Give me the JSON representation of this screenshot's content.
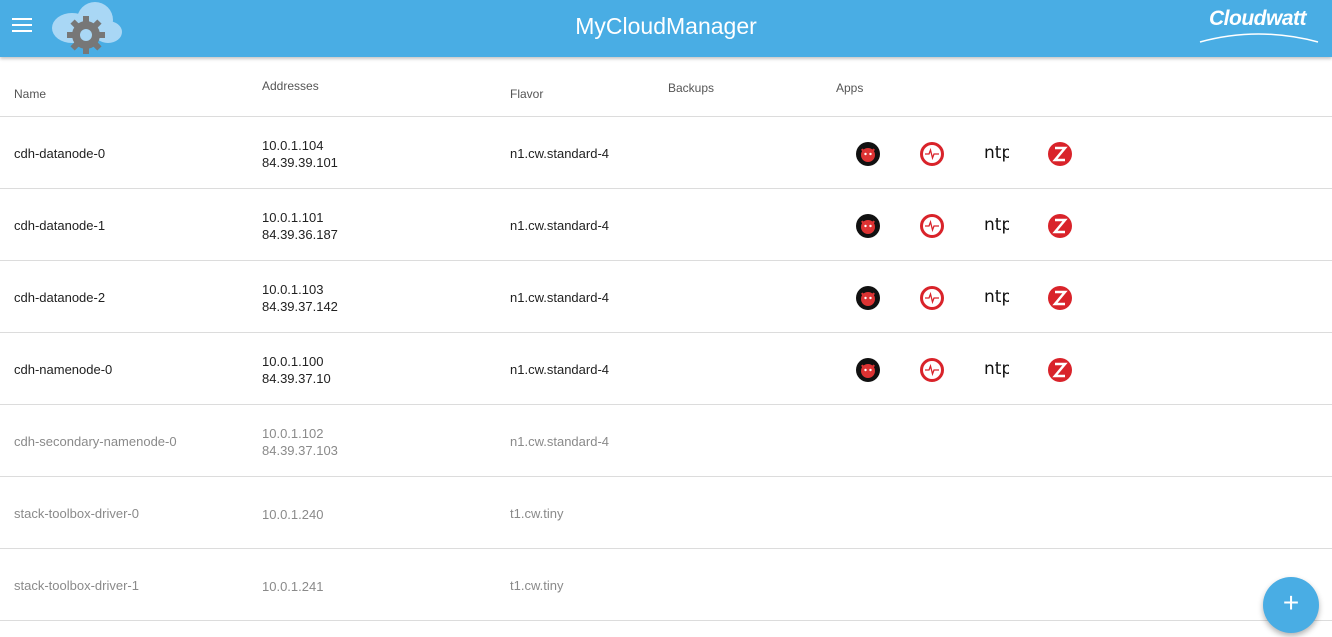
{
  "header": {
    "title": "MyCloudManager",
    "brand": "Cloudwatt",
    "menu_icon": "hamburger-menu-icon",
    "logo_icon": "cloud-gear-logo-icon",
    "background_color": "#49ade4"
  },
  "table": {
    "columns": [
      "Name",
      "Addresses",
      "Flavor",
      "Backups",
      "Apps"
    ],
    "rows": [
      {
        "name": "cdh-datanode-0",
        "address1": "10.0.1.104",
        "address2": "84.39.39.101",
        "flavor": "n1.cw.standard-4",
        "backups": "",
        "active": true
      },
      {
        "name": "cdh-datanode-1",
        "address1": "10.0.1.101",
        "address2": "84.39.36.187",
        "flavor": "n1.cw.standard-4",
        "backups": "",
        "active": true
      },
      {
        "name": "cdh-datanode-2",
        "address1": "10.0.1.103",
        "address2": "84.39.37.142",
        "flavor": "n1.cw.standard-4",
        "backups": "",
        "active": true
      },
      {
        "name": "cdh-namenode-0",
        "address1": "10.0.1.100",
        "address2": "84.39.37.10",
        "flavor": "n1.cw.standard-4",
        "backups": "",
        "active": true
      },
      {
        "name": "cdh-secondary-namenode-0",
        "address1": "10.0.1.102",
        "address2": "84.39.37.103",
        "flavor": "n1.cw.standard-4",
        "backups": "",
        "active": false
      },
      {
        "name": "stack-toolbox-driver-0",
        "address1": "10.0.1.240",
        "address2": "",
        "flavor": "t1.cw.tiny",
        "backups": "",
        "active": false
      },
      {
        "name": "stack-toolbox-driver-1",
        "address1": "10.0.1.241",
        "address2": "",
        "flavor": "t1.cw.tiny",
        "backups": "",
        "active": false
      }
    ],
    "app_icons": {
      "app_a": "red-devil-badge-icon",
      "app_b": "red-pulse-monitor-icon",
      "app_c": "ntp-logo-icon",
      "app_c_text": "ntp",
      "app_d": "red-z-icon"
    }
  },
  "fab": {
    "label": "+",
    "icon": "plus-icon"
  }
}
